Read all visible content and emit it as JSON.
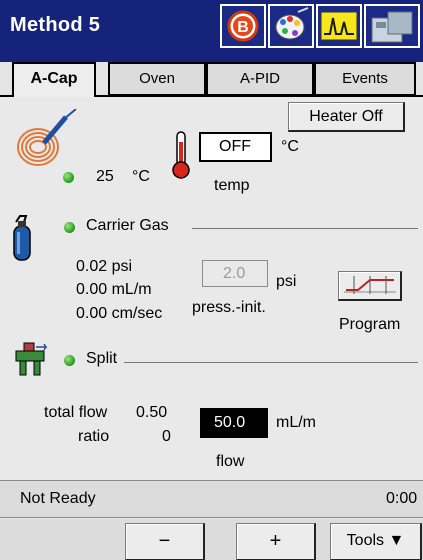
{
  "titlebar": {
    "title": "Method 5",
    "icons": [
      "instrument-b-icon",
      "color-palette-icon",
      "signal-peak-icon",
      "instrument-module-icon"
    ]
  },
  "tabs": [
    {
      "label": "A-Cap",
      "active": true
    },
    {
      "label": "Oven",
      "active": false
    },
    {
      "label": "A-PID",
      "active": false
    },
    {
      "label": "Events",
      "active": false
    }
  ],
  "heater": {
    "button_label": "Heater Off",
    "temperature_value": "25",
    "temperature_unit": "°C",
    "setpoint_value": "OFF",
    "setpoint_unit": "°C",
    "setpoint_caption": "temp"
  },
  "carrier_gas": {
    "title": "Carrier Gas",
    "pressure_reading": "0.02 psi",
    "flow_reading": "0.00 mL/m",
    "velocity_reading": "0.00 cm/sec",
    "pressure_init_value": "2.0",
    "pressure_init_unit": "psi",
    "pressure_init_caption": "press.-init.",
    "program_label": "Program"
  },
  "split": {
    "title": "Split",
    "total_flow_label": "total flow",
    "total_flow_value": "0.50",
    "ratio_label": "ratio",
    "ratio_value": "0",
    "flow_value": "50.0",
    "flow_unit": "mL/m",
    "flow_caption": "flow"
  },
  "status": {
    "text": "Not Ready",
    "time": "0:00"
  },
  "bottombar": {
    "minus_label": "−",
    "plus_label": "+",
    "tools_label": "Tools ▼"
  },
  "colors": {
    "titlebar_bg": "#16237b",
    "led_green": "#2aa52a",
    "active_field_bg": "#000000"
  }
}
